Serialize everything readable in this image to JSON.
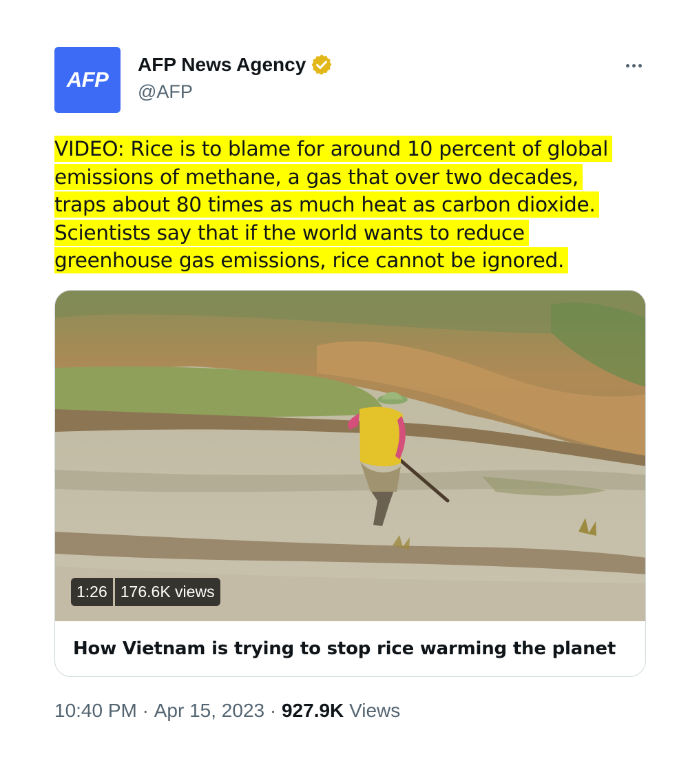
{
  "author": {
    "avatar_text": "AFP",
    "name": "AFP News Agency",
    "handle": "@AFP",
    "verified_icon": "gold-verified-badge-icon"
  },
  "tweet": {
    "text_lines": [
      "VIDEO: Rice is to blame for around 10 percent of global",
      "emissions of methane, a gas that over two decades,",
      "traps about 80 times as much heat as carbon dioxide.",
      "Scientists say that if the world wants to reduce",
      "greenhouse gas emissions, rice cannot be ignored."
    ],
    "highlight_color": "#ffff00"
  },
  "card": {
    "duration": "1:26",
    "views": "176.6K views",
    "title": "How Vietnam is trying to stop rice warming the planet"
  },
  "meta": {
    "time": "10:40 PM",
    "separator": "·",
    "date": "Apr 15, 2023",
    "views_count": "927.9K",
    "views_label": "Views"
  },
  "colors": {
    "avatar_bg": "#3e6bf5",
    "secondary_text": "#536471",
    "primary_text": "#0f1419",
    "border": "#cfd9de"
  }
}
